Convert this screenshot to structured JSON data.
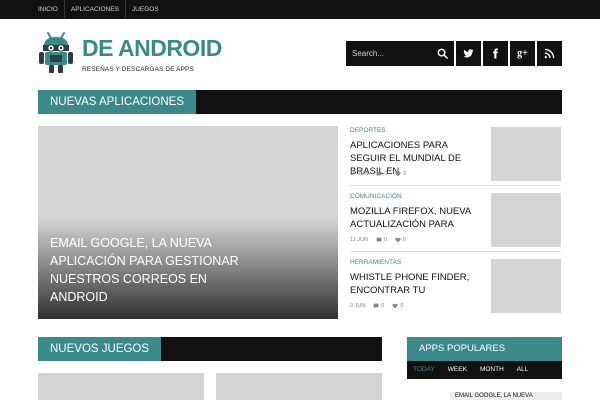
{
  "topnav": {
    "items": [
      {
        "label": "Inicio"
      },
      {
        "label": "Aplicaciones"
      },
      {
        "label": "Juegos"
      }
    ]
  },
  "logo": {
    "brand": "DE ANDROID",
    "tagline": "RESEÑAS Y DESCARGAS DE APPS"
  },
  "search": {
    "placeholder": "Search..."
  },
  "social": [
    {
      "icon": "twitter-icon"
    },
    {
      "icon": "facebook-icon"
    },
    {
      "icon": "google-plus-icon",
      "label": "g+"
    },
    {
      "icon": "rss-icon"
    }
  ],
  "colors": {
    "accent": "#3a8a8b",
    "dark": "#111111",
    "placeholder": "#d4d4d4"
  },
  "sections": {
    "new_apps": "NUEVAS APLICACIONES",
    "new_games": "NUEVOS JUEGOS",
    "popular_apps": "APPS POPULARES"
  },
  "featured": {
    "title": "EMAIL GOOGLE, LA NUEVA APLICACIÓN PARA GESTIONAR NUESTROS CORREOS EN ANDROID"
  },
  "posts": [
    {
      "category": "DEPORTES",
      "title": "APLICACIONES PARA SEGUIR EL MUNDIAL DE BRASIL EN",
      "date": "16 JUN",
      "comments": "0",
      "likes": "0"
    },
    {
      "category": "COMUNICACIÓN",
      "title": "MOZILLA FIREFOX, NUEVA ACTUALIZACIÓN PARA",
      "date": "11 JUN",
      "comments": "0",
      "likes": "0"
    },
    {
      "category": "HERRAMIENTAS",
      "title": "WHISTLE PHONE FINDER, ENCONTRAR TU",
      "date": "9 JUN",
      "comments": "0",
      "likes": "0"
    }
  ],
  "popular_tabs": [
    {
      "label": "TODAY",
      "active": true
    },
    {
      "label": "WEEK"
    },
    {
      "label": "MONTH"
    },
    {
      "label": "ALL"
    }
  ],
  "popular_items": [
    {
      "title": "EMAIL GOOGLE, LA NUEVA"
    }
  ]
}
